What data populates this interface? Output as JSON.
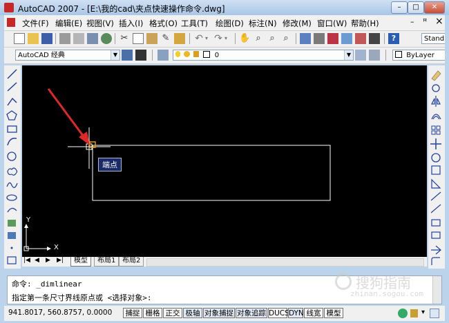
{
  "window": {
    "title": "AutoCAD 2007 - [E:\\我的cad\\夹点快速操作命令.dwg]",
    "min_glyph": "–",
    "max_glyph": "□",
    "close_glyph": "✕",
    "doc_min_glyph": "–",
    "doc_restore_glyph": "ꟸ",
    "doc_close_glyph": "×"
  },
  "menu": {
    "items": [
      "文件(F)",
      "编辑(E)",
      "视图(V)",
      "插入(I)",
      "格式(O)",
      "工具(T)",
      "绘图(D)",
      "标注(N)",
      "修改(M)",
      "窗口(W)",
      "帮助(H)"
    ]
  },
  "toolbar2": {
    "workspace": "AutoCAD 经典",
    "layer": "0",
    "bylayer": "ByLayer",
    "style_partial": "Stand"
  },
  "drawing": {
    "tooltip": "端点",
    "ucs_x": "X",
    "ucs_y": "Y"
  },
  "tabs": {
    "items": [
      "模型",
      "布局1",
      "布局2"
    ]
  },
  "command": {
    "line1": "命令: _dimlinear",
    "line2": "指定第一条尺寸界线原点或 <选择对象>:"
  },
  "status": {
    "coords": "941.8017,  560.8757, 0.0000",
    "toggles": [
      "捕捉",
      "栅格",
      "正交",
      "极轴",
      "对象捕捉",
      "对象追踪",
      "DUCS",
      "DYN",
      "线宽",
      "模型"
    ]
  },
  "watermark": {
    "text": "搜狗指南",
    "url": "zhinan.sogou.com"
  },
  "colors": {
    "canvas": "#000000",
    "rectangle": "#ffffff",
    "grip": "#e0a000",
    "arrow": "#e02828",
    "tooltip_bg": "#1a2a66"
  }
}
